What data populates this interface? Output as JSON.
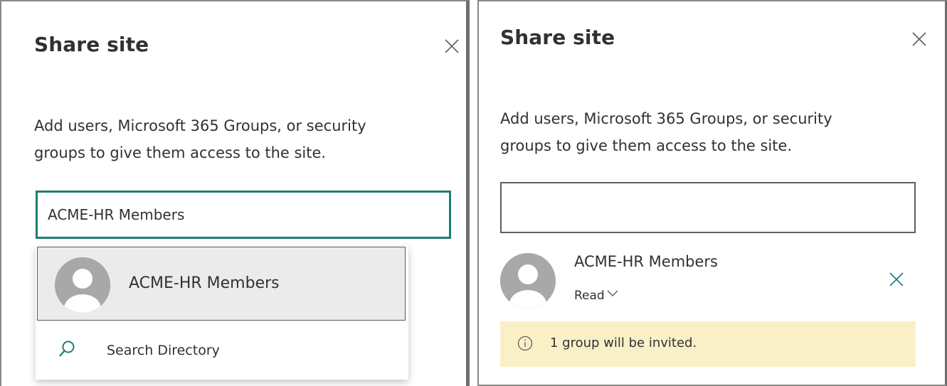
{
  "left_panel": {
    "title": "Share site",
    "description_line1": "Add users, Microsoft 365 Groups, or security",
    "description_line2": "groups to give them access to the site.",
    "input_value": "ACME-HR Members",
    "suggestion": {
      "name": "ACME-HR Members"
    },
    "search_directory_label": "Search Directory",
    "close_icon": "close-icon",
    "search_icon": "search-icon"
  },
  "right_panel": {
    "title": "Share site",
    "description_line1": "Add users, Microsoft 365 Groups, or security",
    "description_line2": "groups to give them access to the site.",
    "input_value": "",
    "member": {
      "name": "ACME-HR Members",
      "permission": "Read"
    },
    "notice_text": "1 group will be invited.",
    "close_icon": "close-icon",
    "info_icon": "info-icon"
  },
  "colors": {
    "focus_border": "#1f7d78",
    "notice_bg": "#faf0c8",
    "selected_bg": "#ebebeb",
    "text": "#323130"
  }
}
